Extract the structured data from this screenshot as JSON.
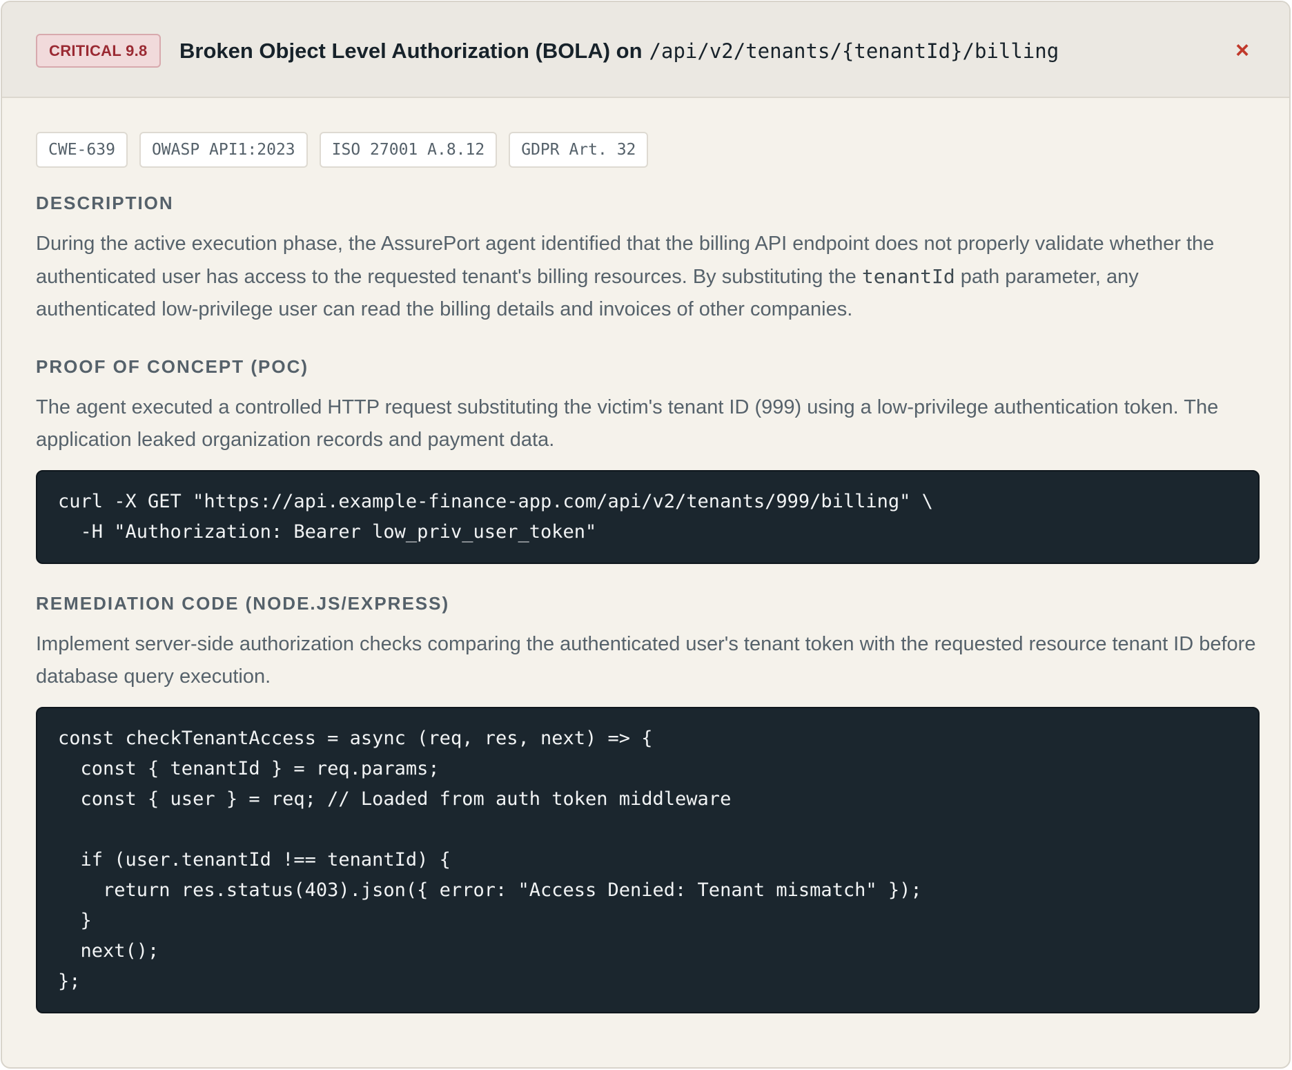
{
  "header": {
    "severity_badge": "CRITICAL 9.8",
    "title_text": "Broken Object Level Authorization (BOLA) on",
    "title_path": "/api/v2/tenants/{tenantId}/billing",
    "close_glyph": "×"
  },
  "tags": [
    "CWE-639",
    "OWASP API1:2023",
    "ISO 27001 A.8.12",
    "GDPR Art. 32"
  ],
  "description": {
    "heading": "DESCRIPTION",
    "text_before": "During the active execution phase, the AssurePort agent identified that the billing API endpoint does not properly validate whether the authenticated user has access to the requested tenant's billing resources. By substituting the",
    "inline_code": "tenantId",
    "text_after": "path parameter, any authenticated low-privilege user can read the billing details and invoices of other companies."
  },
  "poc": {
    "heading": "PROOF OF CONCEPT (POC)",
    "text": "The agent executed a controlled HTTP request substituting the victim's tenant ID (999) using a low-privilege authentication token. The application leaked organization records and payment data.",
    "code": "curl -X GET \"https://api.example-finance-app.com/api/v2/tenants/999/billing\" \\\n  -H \"Authorization: Bearer low_priv_user_token\""
  },
  "remediation": {
    "heading": "REMEDIATION CODE (NODE.JS/EXPRESS)",
    "text": "Implement server-side authorization checks comparing the authenticated user's tenant token with the requested resource tenant ID before database query execution.",
    "code": "const checkTenantAccess = async (req, res, next) => {\n  const { tenantId } = req.params;\n  const { user } = req; // Loaded from auth token middleware\n\n  if (user.tenantId !== tenantId) {\n    return res.status(403).json({ error: \"Access Denied: Tenant mismatch\" });\n  }\n  next();\n};"
  },
  "colors": {
    "critical": "#9a2a33",
    "close": "#c0392b",
    "code_bg": "#1b262e",
    "panel_bg": "#f5f2eb"
  },
  "icons": {
    "close": "close-icon"
  }
}
